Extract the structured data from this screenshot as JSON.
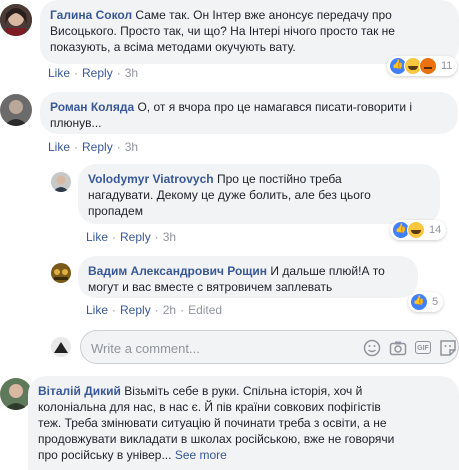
{
  "comments": [
    {
      "author": "Галина Сокол",
      "lines": [
        "Саме так. Он Інтер вже анонсує передачу про",
        "Висоцького. Просто так, чи що? На Інтері нічого просто так не",
        "показують, а всіма методами окучують вату."
      ],
      "like": "Like",
      "reply": "Reply",
      "time": "3h",
      "reaction_count": "11",
      "reactions": [
        "like-reaction-icon",
        "haha-reaction-icon",
        "angry-reaction-icon"
      ]
    },
    {
      "author": "Роман Коляда",
      "lines": [
        "О, от я вчора про це намагався писати-говорити і",
        "плюнув..."
      ],
      "like": "Like",
      "reply": "Reply",
      "time": "3h"
    },
    {
      "author": "Volodymyr Viatrovych",
      "lines": [
        "Про це постійно треба",
        "нагадувати. Декому це дуже болить, але без цього",
        "пропадем"
      ],
      "like": "Like",
      "reply": "Reply",
      "time": "3h",
      "reaction_count": "14",
      "reactions": [
        "like-reaction-icon",
        "haha-reaction-icon"
      ]
    },
    {
      "author": "Вадим Александрович Рощин",
      "lines": [
        "И дальше плюй!А то",
        "могут и вас вместе с вятровичем заплевать"
      ],
      "like": "Like",
      "reply": "Reply",
      "time": "2h",
      "edited": "Edited",
      "reaction_count": "5",
      "reactions": [
        "like-reaction-icon"
      ]
    },
    {
      "author": "Віталій Дикий",
      "lines": [
        "Візьміть себе в руки. Спільна історія, хоч й",
        "колоніальна для нас, в нас є. Й пів країни совкових пофігістів",
        "теж. Треба змінювати ситуацію й починати треба з освіти, а не",
        "продовжувати викладати в школах російською, вже не говорячи",
        "про російську в універ..."
      ],
      "see_more": "See more"
    }
  ],
  "reply_box": {
    "placeholder": "Write a comment..."
  },
  "colors": {
    "link": "#385898",
    "meta": "#90949c",
    "bubble": "#f2f3f5"
  }
}
